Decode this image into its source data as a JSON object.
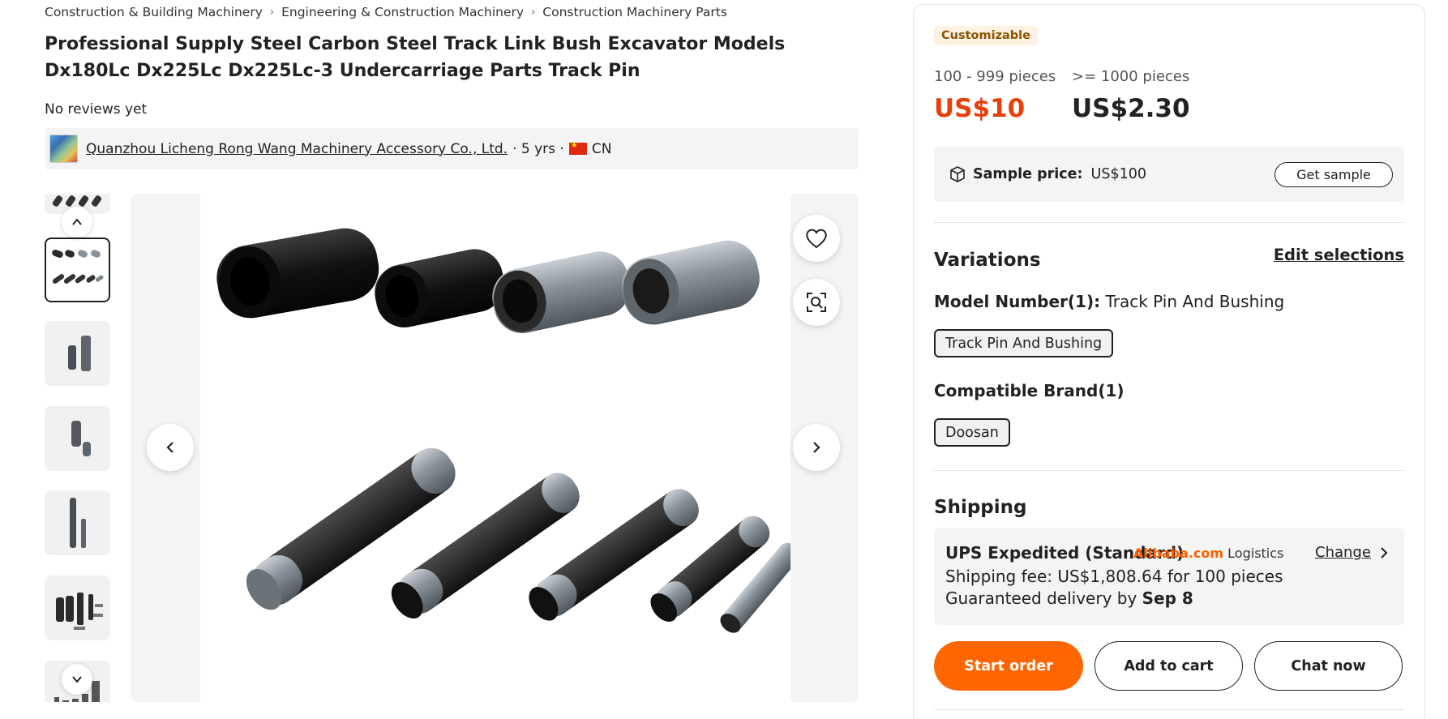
{
  "breadcrumb": [
    "Construction & Building Machinery",
    "Engineering & Construction Machinery",
    "Construction Machinery Parts"
  ],
  "product": {
    "title": "Professional Supply Steel Carbon Steel Track Link Bush Excavator Models Dx180Lc Dx225Lc Dx225Lc-3 Undercarriage Parts Track Pin",
    "reviews": "No reviews yet"
  },
  "supplier": {
    "name": "Quanzhou Licheng Rong Wang Machinery Accessory Co., Ltd.",
    "years": "· 5 yrs ·",
    "country": "CN"
  },
  "pricing": {
    "badge": "Customizable",
    "tiers": [
      {
        "range": "100 - 999 pieces",
        "price": "US$10"
      },
      {
        "range": ">= 1000 pieces",
        "price": "US$2.30"
      }
    ],
    "sample_label": "Sample price:",
    "sample_value": "US$100",
    "get_sample": "Get sample"
  },
  "variations": {
    "title": "Variations",
    "edit": "Edit selections",
    "model_label": "Model Number(1):",
    "model_value": "Track Pin And Bushing",
    "model_option": "Track Pin And Bushing",
    "brand_label": "Compatible Brand(1)",
    "brand_option": "Doosan"
  },
  "shipping": {
    "title": "Shipping",
    "method": "UPS Expedited (Standard)",
    "logistics_brand": "Alibaba.com",
    "logistics_text": "Logistics",
    "change": "Change",
    "fee": "Shipping fee: US$1,808.64 for 100 pieces",
    "delivery_prefix": "Guaranteed delivery by",
    "delivery_date": "Sep 8"
  },
  "actions": {
    "start_order": "Start order",
    "add_to_cart": "Add to cart",
    "chat_now": "Chat now"
  },
  "colors": {
    "accent": "#ff6600",
    "price_red": "#e5400b"
  }
}
